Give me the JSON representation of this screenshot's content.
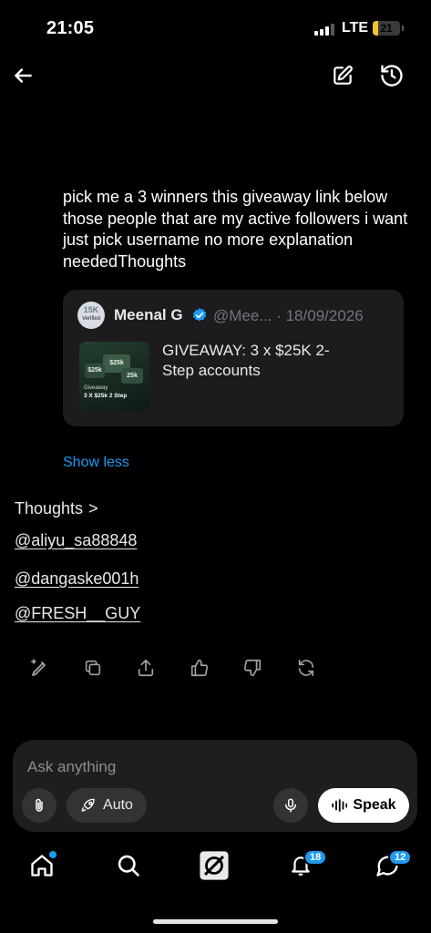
{
  "status_bar": {
    "time": "21:05",
    "network": "LTE",
    "battery": "21",
    "battery_fraction": 0.21
  },
  "header": {
    "back_icon": "arrow-left-icon",
    "compose_icon": "edit-icon",
    "history_icon": "history-icon"
  },
  "message": {
    "text": "pick me a 3 winners this giveaway link below those people that are my active followers i want just pick username no more explanation neededThoughts"
  },
  "quote": {
    "avatar_badge": "15K",
    "avatar_sub": "Verified",
    "name": "Meenal G",
    "handle": "@Mee... · 18/09/2026",
    "text": "GIVEAWAY: 3 x $25K 2-Step accounts",
    "thumb": {
      "tile_a": "$25k",
      "tile_b": "$25k",
      "tile_c": "25k",
      "caption": "Giveaway",
      "caption2": "3 X $25k 2 Step"
    }
  },
  "show_less": "Show less",
  "thoughts": {
    "label": "Thoughts",
    "chevron": ">",
    "winners": [
      "@aliyu_sa88848",
      "@dangaske001h",
      "@FRESH__GUY"
    ]
  },
  "actions": [
    "edit-sparkle-icon",
    "copy-icon",
    "share-icon",
    "thumbs-up-icon",
    "thumbs-down-icon",
    "regenerate-icon"
  ],
  "composer": {
    "placeholder": "Ask anything",
    "auto_label": "Auto",
    "speak_label": "Speak"
  },
  "bottom_nav": {
    "notifications_badge": "18",
    "messages_badge": "12"
  },
  "colors": {
    "accent": "#1d9bf0",
    "background": "#000000",
    "battery": "#f4c430"
  }
}
